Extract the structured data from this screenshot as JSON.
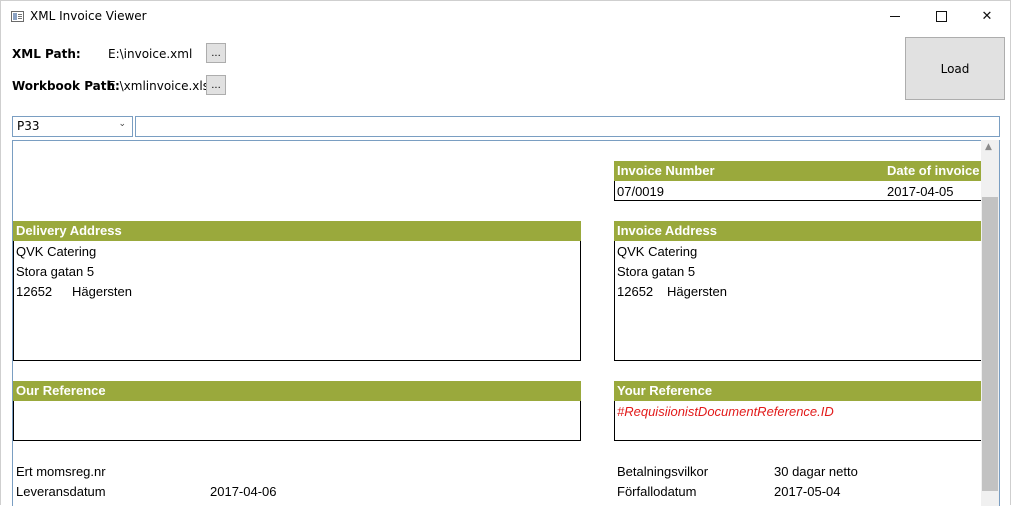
{
  "window": {
    "title": "XML Invoice Viewer",
    "minimize": "–",
    "maximize": "☐",
    "close": "✕"
  },
  "form": {
    "xml_path_label": "XML Path:",
    "xml_path_value": "E:\\invoice.xml",
    "workbook_path_label": "Workbook Path:",
    "workbook_path_value": "E:\\xmlinvoice.xlsx",
    "browse_label": "...",
    "load_label": "Load"
  },
  "formula_bar": {
    "cell_ref": "P33",
    "content": ""
  },
  "sheet": {
    "invoice_number_header": "Invoice Number",
    "invoice_number": "07/0019",
    "date_header": "Date of invoice",
    "date": "2017-04-05",
    "delivery_address": {
      "header": "Delivery Address",
      "name": "QVK Catering",
      "street": "Stora gatan 5",
      "zip": "12652",
      "city": "Hägersten"
    },
    "invoice_address": {
      "header": "Invoice Address",
      "name": "QVK Catering",
      "street": "Stora gatan 5",
      "zip": "12652",
      "city": "Hägersten"
    },
    "our_reference_header": "Our Reference",
    "your_reference_header": "Your Reference",
    "your_reference_value": "#RequisiionistDocumentReference.ID",
    "vat_label": "Ert momsreg.nr",
    "delivery_date_label": "Leveransdatum",
    "delivery_date": "2017-04-06",
    "payment_terms_label": "Betalningsvilkor",
    "payment_terms": "30 dagar netto",
    "due_date_label": "Förfallodatum",
    "due_date": "2017-05-04"
  },
  "colors": {
    "header_bg": "#9aa93c",
    "reference_red": "#e21b1b"
  }
}
